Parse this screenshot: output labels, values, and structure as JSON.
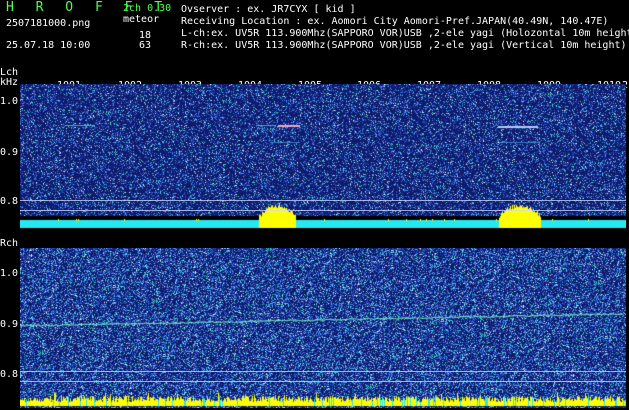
{
  "header": {
    "app_title": "H R O F F T",
    "version": "2ch 0.30",
    "filename": "2507181000.png",
    "datetime": "25.07.18 10:00",
    "meteor_label": "meteor",
    "lch_count": "18",
    "rch_count": "63",
    "observer_line": "Ovserver             : ex. JR7CYX [ kid ]",
    "location_line": "Receiving Location : ex. Aomori City Aomori-Pref.JAPAN(40.49N, 140.47E)",
    "lch_line": "L-ch:ex. UV5R 113.900Mhz(SAPPORO VOR)USB ,2-ele yagi (Holozontal 10m height)",
    "rch_line": "R-ch:ex. UV5R 113.900Mhz(SAPPORO VOR)USB ,2-ele yagi (Vertical 10m height)"
  },
  "time_axis": {
    "labels": [
      "1001",
      "1002",
      "1003",
      "1004",
      "1005",
      "1006",
      "1007",
      "1008",
      "1009",
      "1010",
      "2"
    ]
  },
  "lch": {
    "channel_label": "Lch",
    "unit_label": "kHz",
    "freq_ticks": [
      "1.0",
      "0.9",
      "0.8"
    ],
    "bursts": [
      [
        0.395,
        0.455
      ],
      [
        0.79,
        0.86
      ]
    ]
  },
  "rch": {
    "channel_label": "Rch",
    "freq_ticks": [
      "1.0",
      "0.9",
      "0.8"
    ]
  },
  "colors": {
    "panel_bg": "#101a6a",
    "meter_cyan": "#27e8f0",
    "meter_yellow": "#ffff00",
    "title_green": "#4cff4c"
  }
}
